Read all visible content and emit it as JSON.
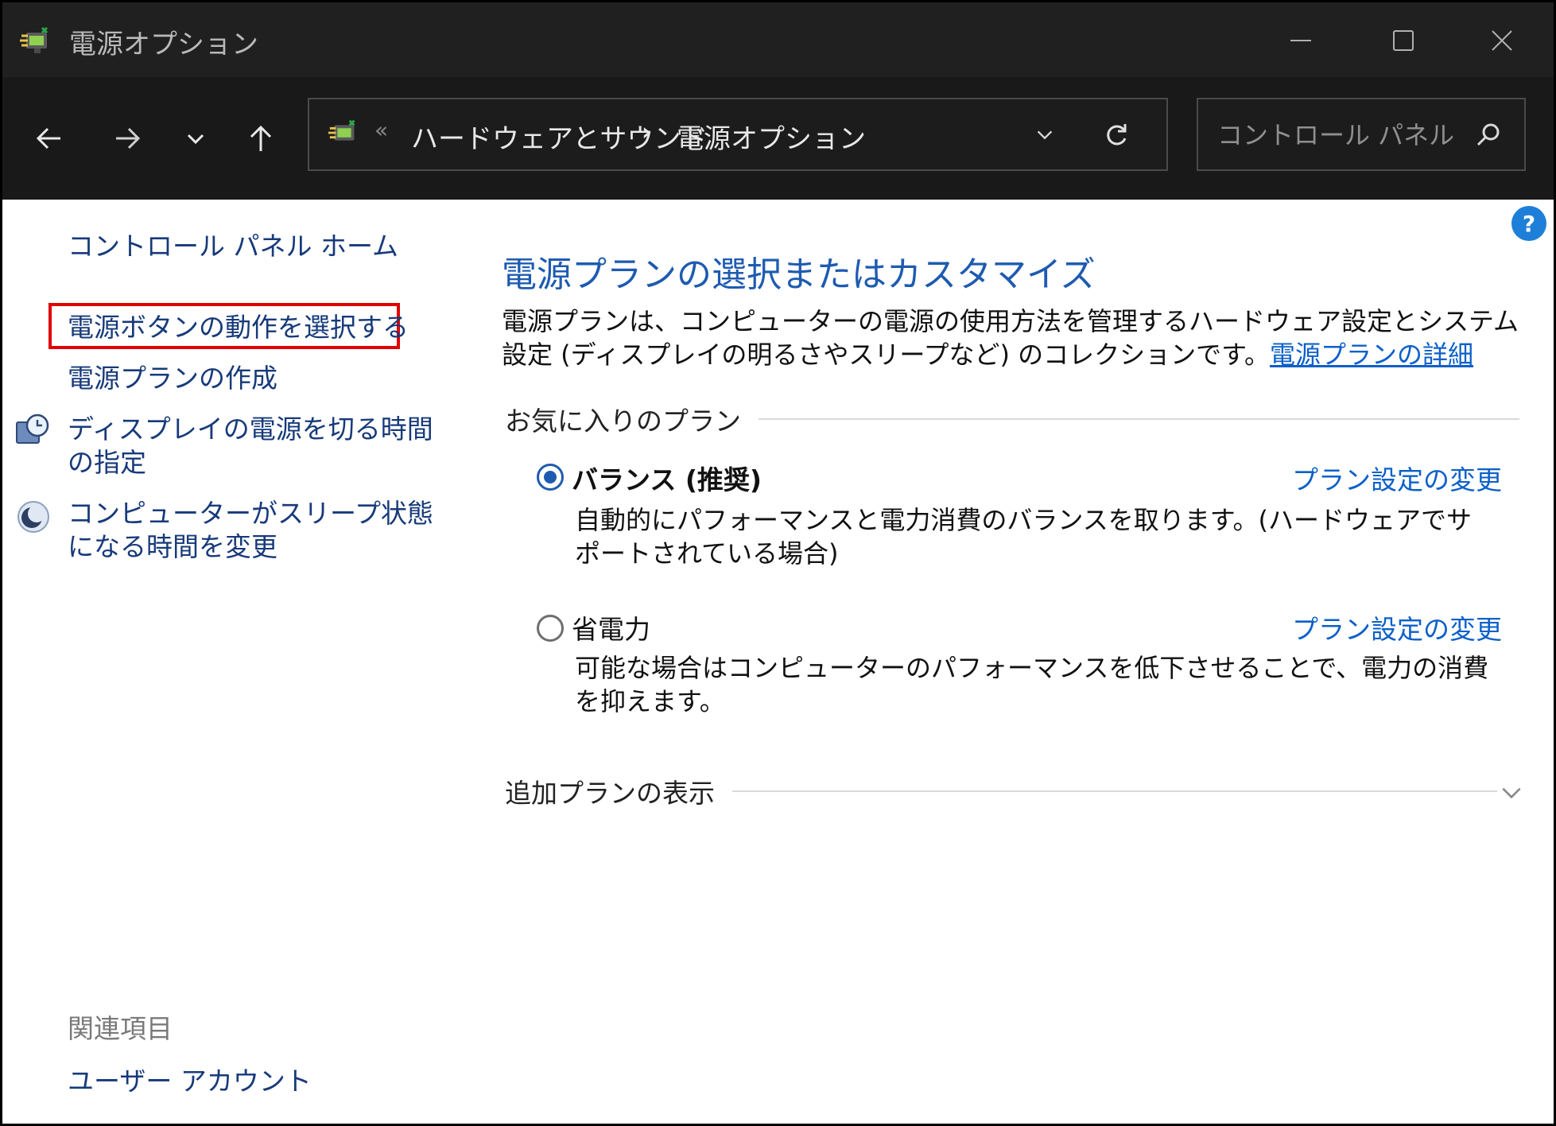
{
  "window": {
    "title": "電源オプション"
  },
  "nav": {
    "breadcrumb_sep": "«",
    "crumbs": [
      "ハードウェアとサウンド",
      "電源オプション"
    ],
    "crumb_arrow": "›",
    "search_placeholder": "コントロール パネル..."
  },
  "sidebar": {
    "home": "コントロール パネル ホーム",
    "items": [
      "電源ボタンの動作を選択する",
      "電源プランの作成",
      "ディスプレイの電源を切る時間の指定",
      "コンピューターがスリープ状態になる時間を変更"
    ],
    "related_title": "関連項目",
    "related_items": [
      "ユーザー アカウント"
    ]
  },
  "main": {
    "title": "電源プランの選択またはカスタマイズ",
    "description": "電源プランは、コンピューターの電源の使用方法を管理するハードウェア設定とシステム設定 (ディスプレイの明るさやスリープなど) のコレクションです。",
    "details_link": "電源プランの詳細",
    "favorites_label": "お気に入りのプラン",
    "plans": [
      {
        "name": "バランス (推奨)",
        "selected": true,
        "change_link": "プラン設定の変更",
        "description": "自動的にパフォーマンスと電力消費のバランスを取ります。(ハードウェアでサポートされている場合)"
      },
      {
        "name": "省電力",
        "selected": false,
        "change_link": "プラン設定の変更",
        "description": "可能な場合はコンピューターのパフォーマンスを低下させることで、電力の消費を抑えます。"
      }
    ],
    "more_plans_label": "追加プランの表示"
  },
  "help_label": "?",
  "colors": {
    "titlebar_bg": "#202020",
    "navbar_bg": "#191919",
    "link": "#0b60c9",
    "heading": "#1e5bb0",
    "highlight": "#e00000"
  },
  "icons": {
    "app": "power-options-icon",
    "back": "arrow-left-icon",
    "forward": "arrow-right-icon",
    "recent": "chevron-down-icon",
    "up": "arrow-up-icon",
    "refresh": "refresh-icon",
    "search": "search-icon",
    "help": "help-icon",
    "display": "clock-display-icon",
    "sleep": "moon-icon"
  }
}
